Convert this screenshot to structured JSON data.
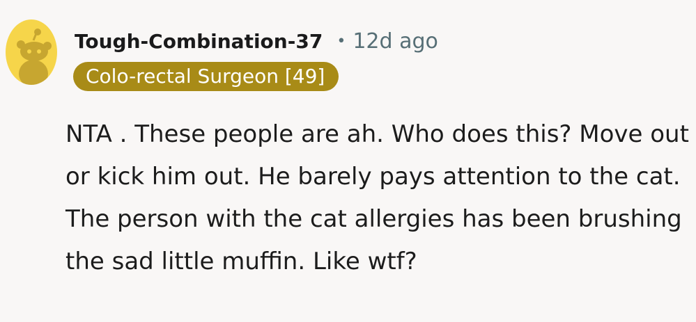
{
  "comment": {
    "author": "Tough-Combination-37",
    "separator": "•",
    "time_ago": "12d ago",
    "flair": "Colo-rectal Surgeon [49]",
    "body": "NTA . These people are ah. Who does this? Move out or kick him out. He barely pays attention to the cat. The person with the cat allergies has been brushing the sad little muffin. Like wtf?"
  },
  "colors": {
    "avatar_background": "#f6d54a",
    "avatar_figure": "#c7a630",
    "flair_background": "#a88b17",
    "page_background": "#f9f7f6"
  },
  "icons": {
    "avatar": "snoo-avatar-icon"
  }
}
